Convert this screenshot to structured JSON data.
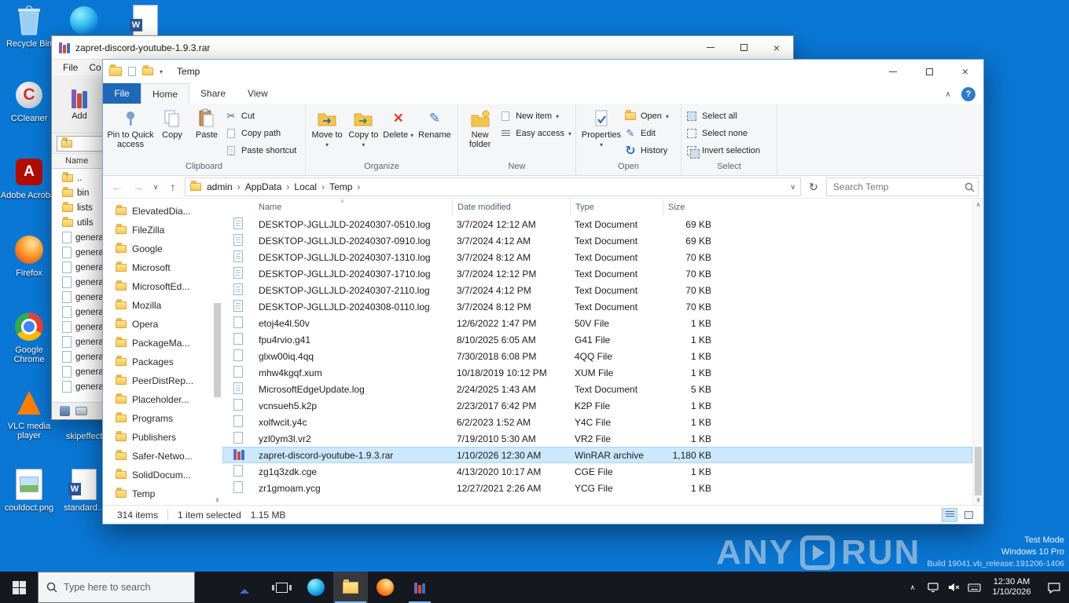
{
  "desktop": {
    "icons": [
      "Recycle Bin",
      "CCleaner",
      "Adobe Acrobat",
      "Firefox",
      "Google Chrome",
      "VLC media player",
      "couldoct.png",
      "skipeffect",
      "standard..."
    ]
  },
  "winrar": {
    "title": "zapret-discord-youtube-1.9.3.rar",
    "menu": [
      "File",
      "Co"
    ],
    "add_label": "Add",
    "name_column": "Name",
    "items": [
      {
        "label": "..",
        "kind": "updir"
      },
      {
        "label": "bin",
        "kind": "folder"
      },
      {
        "label": "lists",
        "kind": "folder"
      },
      {
        "label": "utils",
        "kind": "folder"
      },
      {
        "label": "genera...",
        "kind": "file"
      },
      {
        "label": "genera...",
        "kind": "file"
      },
      {
        "label": "genera...",
        "kind": "file"
      },
      {
        "label": "genera...",
        "kind": "file"
      },
      {
        "label": "genera...",
        "kind": "file"
      },
      {
        "label": "genera...",
        "kind": "file"
      },
      {
        "label": "genera...",
        "kind": "file"
      },
      {
        "label": "genera...",
        "kind": "file"
      },
      {
        "label": "genera...",
        "kind": "file"
      },
      {
        "label": "genera...",
        "kind": "file"
      },
      {
        "label": "genera...",
        "kind": "file"
      }
    ]
  },
  "explorer": {
    "title": "Temp",
    "tabs": [
      "File",
      "Home",
      "Share",
      "View"
    ],
    "ribbon": {
      "clipboard": {
        "label": "Clipboard",
        "pin": "Pin to Quick access",
        "copy": "Copy",
        "paste": "Paste",
        "cut": "Cut",
        "copy_path": "Copy path",
        "paste_shortcut": "Paste shortcut"
      },
      "organize": {
        "label": "Organize",
        "move_to": "Move to",
        "copy_to": "Copy to",
        "delete": "Delete",
        "rename": "Rename"
      },
      "new": {
        "label": "New",
        "new_folder": "New folder",
        "new_item": "New item",
        "easy_access": "Easy access"
      },
      "open": {
        "label": "Open",
        "properties": "Properties",
        "open": "Open",
        "edit": "Edit",
        "history": "History"
      },
      "select": {
        "label": "Select",
        "select_all": "Select all",
        "select_none": "Select none",
        "invert": "Invert selection"
      }
    },
    "address": {
      "crumbs": [
        "admin",
        "AppData",
        "Local",
        "Temp"
      ],
      "search_placeholder": "Search Temp"
    },
    "tree": [
      "ElevatedDia...",
      "FileZilla",
      "Google",
      "Microsoft",
      "MicrosoftEd...",
      "Mozilla",
      "Opera",
      "PackageMa...",
      "Packages",
      "PeerDistRep...",
      "Placeholder...",
      "Programs",
      "Publishers",
      "Safer-Netwo...",
      "SolidDocum...",
      "Temp"
    ],
    "columns": [
      "Name",
      "Date modified",
      "Type",
      "Size"
    ],
    "files": [
      {
        "name": "DESKTOP-JGLLJLD-20240307-0510.log",
        "date": "3/7/2024 12:12 AM",
        "type": "Text Document",
        "size": "69 KB",
        "icon": "log",
        "selected": false
      },
      {
        "name": "DESKTOP-JGLLJLD-20240307-0910.log",
        "date": "3/7/2024 4:12 AM",
        "type": "Text Document",
        "size": "69 KB",
        "icon": "log",
        "selected": false
      },
      {
        "name": "DESKTOP-JGLLJLD-20240307-1310.log",
        "date": "3/7/2024 8:12 AM",
        "type": "Text Document",
        "size": "70 KB",
        "icon": "log",
        "selected": false
      },
      {
        "name": "DESKTOP-JGLLJLD-20240307-1710.log",
        "date": "3/7/2024 12:12 PM",
        "type": "Text Document",
        "size": "70 KB",
        "icon": "log",
        "selected": false
      },
      {
        "name": "DESKTOP-JGLLJLD-20240307-2110.log",
        "date": "3/7/2024 4:12 PM",
        "type": "Text Document",
        "size": "70 KB",
        "icon": "log",
        "selected": false
      },
      {
        "name": "DESKTOP-JGLLJLD-20240308-0110.log",
        "date": "3/7/2024 8:12 PM",
        "type": "Text Document",
        "size": "70 KB",
        "icon": "log",
        "selected": false
      },
      {
        "name": "etoj4e4l.50v",
        "date": "12/6/2022 1:47 PM",
        "type": "50V File",
        "size": "1 KB",
        "icon": "file",
        "selected": false
      },
      {
        "name": "fpu4rvio.g41",
        "date": "8/10/2025 6:05 AM",
        "type": "G41 File",
        "size": "1 KB",
        "icon": "file",
        "selected": false
      },
      {
        "name": "glxw00iq.4qq",
        "date": "7/30/2018 6:08 PM",
        "type": "4QQ File",
        "size": "1 KB",
        "icon": "file",
        "selected": false
      },
      {
        "name": "mhw4kgqf.xum",
        "date": "10/18/2019 10:12 PM",
        "type": "XUM File",
        "size": "1 KB",
        "icon": "file",
        "selected": false
      },
      {
        "name": "MicrosoftEdgeUpdate.log",
        "date": "2/24/2025 1:43 AM",
        "type": "Text Document",
        "size": "5 KB",
        "icon": "log",
        "selected": false
      },
      {
        "name": "vcnsueh5.k2p",
        "date": "2/23/2017 6:42 PM",
        "type": "K2P File",
        "size": "1 KB",
        "icon": "file",
        "selected": false
      },
      {
        "name": "xolfwcit.y4c",
        "date": "6/2/2023 1:52 AM",
        "type": "Y4C File",
        "size": "1 KB",
        "icon": "file",
        "selected": false
      },
      {
        "name": "yzl0ym3l.vr2",
        "date": "7/19/2010 5:30 AM",
        "type": "VR2 File",
        "size": "1 KB",
        "icon": "file",
        "selected": false
      },
      {
        "name": "zapret-discord-youtube-1.9.3.rar",
        "date": "1/10/2026 12:30 AM",
        "type": "WinRAR archive",
        "size": "1,180 KB",
        "icon": "rar",
        "selected": true
      },
      {
        "name": "zg1q3zdk.cge",
        "date": "4/13/2020 10:17 AM",
        "type": "CGE File",
        "size": "1 KB",
        "icon": "file",
        "selected": false
      },
      {
        "name": "zr1gmoam.ycg",
        "date": "12/27/2021 2:26 AM",
        "type": "YCG File",
        "size": "1 KB",
        "icon": "file",
        "selected": false
      }
    ],
    "status_bar": {
      "items_count": "314 items",
      "selection": "1 item selected",
      "selection_size": "1.15 MB"
    }
  },
  "watermark": {
    "brand_left": "ANY",
    "brand_right": "RUN",
    "mode": "Test Mode",
    "os": "Windows 10 Pro",
    "build": "Build 19041.vb_release.191206-1406"
  },
  "taskbar": {
    "search_placeholder": "Type here to search",
    "clock_time": "12:30 AM",
    "clock_date": "1/10/2026"
  }
}
